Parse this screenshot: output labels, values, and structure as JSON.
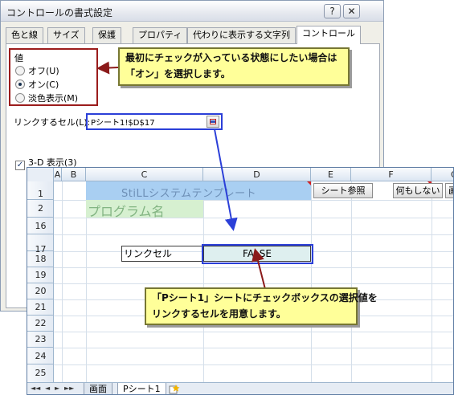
{
  "dialog": {
    "title": "コントロールの書式設定",
    "help_glyph": "?",
    "close_glyph": "✕",
    "tabs": [
      "色と線",
      "サイズ",
      "保護",
      "プロパティ",
      "代わりに表示する文字列",
      "コントロール"
    ],
    "active_tab": "コントロール",
    "value_group": {
      "title": "値",
      "options": [
        {
          "label": "オフ(U)",
          "selected": false
        },
        {
          "label": "オン(C)",
          "selected": true
        },
        {
          "label": "淡色表示(M)",
          "selected": false
        }
      ]
    },
    "link_cell": {
      "label": "リンクするセル(L):",
      "value": "Pシート1!$D$17"
    },
    "checkbox_3d": {
      "label": "3-D 表示(3)",
      "checked": true,
      "glyph": "✓"
    }
  },
  "callouts": {
    "top": {
      "line1": "最初にチェックが入っている状態にしたい場合は",
      "line2": "「オン」を選択します。"
    },
    "bottom": {
      "line1": "「Pシート1」シートにチェックボックスの選択値を",
      "line2": "リンクするセルを用意します。"
    }
  },
  "spreadsheet": {
    "columns": [
      "A",
      "B",
      "C",
      "D",
      "E",
      "F",
      "G"
    ],
    "rows": [
      "1",
      "2",
      "16",
      "17",
      "18",
      "19",
      "20",
      "21",
      "22",
      "23",
      "24",
      "25"
    ],
    "title_cell": "StiLLシステムテンプレート",
    "program_cell": "プログラム名",
    "buttons": [
      "シート参照",
      "何もしない",
      "画面表示"
    ],
    "link_label_cell": "リンクセル",
    "link_value_cell": "FALSE",
    "sheet_tabs": [
      "画面",
      "Pシート1"
    ],
    "active_sheet": "Pシート1",
    "nav_arrows": [
      "◄◄",
      "◄",
      "►",
      "►►"
    ]
  },
  "colors": {
    "callout_bg": "#ffff99",
    "highlight_red": "#9b1c1c",
    "highlight_blue": "#2b3fd8",
    "title_band": "#a9cff2",
    "program_band": "#d6f0d0"
  }
}
